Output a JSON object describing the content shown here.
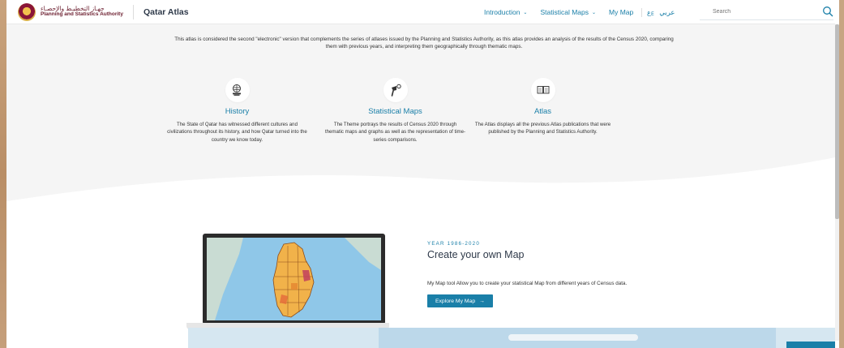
{
  "header": {
    "logo_text_ar": "جهـاز التخطيـط والإحصـاء",
    "logo_text_en": "Planning and Statistics Authority",
    "app_title": "Qatar Atlas",
    "nav": [
      {
        "label": "Introduction",
        "has_dropdown": true
      },
      {
        "label": "Statistical Maps",
        "has_dropdown": true
      },
      {
        "label": "My Map",
        "has_dropdown": false
      }
    ],
    "language_label": "عربي",
    "language_icon": "language-icon",
    "search_placeholder": "Search"
  },
  "intro": {
    "text": "This atlas is considered the second \"electronic\" version that complements the series of atlases issued by the Planning and Statistics Authority, as this atlas provides an analysis of the results of the Census 2020, comparing them with previous years, and interpreting them geographically through thematic maps."
  },
  "features": [
    {
      "icon": "globe-history-icon",
      "title": "History",
      "description": "The State of Qatar has witnessed different cultures and civilizations throughout its history, and how Qatar turned into the country we know today."
    },
    {
      "icon": "map-pin-icon",
      "title": "Statistical Maps",
      "description": "The Theme portrays the results of Census 2020 through thematic maps and graphs as well as the representation of time-series comparisons."
    },
    {
      "icon": "open-book-icon",
      "title": "Atlas",
      "description": "The Atlas displays all the previous Atlas publications that were published by the Planning and Statistics Authority."
    }
  ],
  "my_map_section": {
    "eyebrow": "YEAR 1986-2020",
    "title": "Create your own Map",
    "description": "My Map tool Allow you to create your statistical Map from different years of Census data.",
    "button_label": "Explore My Map",
    "button_icon": "arrow-right-icon"
  },
  "colors": {
    "accent": "#1a7fa8",
    "brand_maroon": "#6b1d2e",
    "hero_bg": "#f5f5f5",
    "map_land": "#f1b24a",
    "map_sea": "#8fc7e8"
  }
}
